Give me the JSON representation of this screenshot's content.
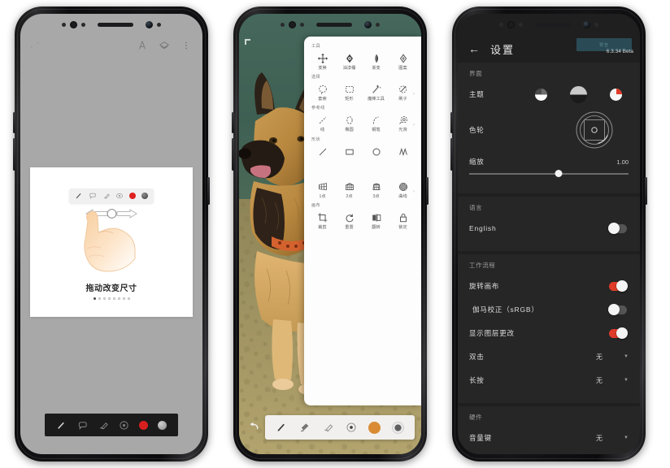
{
  "left_phone": {
    "topbar": {
      "icons": [
        "transform-icon",
        "layers-icon",
        "overflow-menu-icon"
      ],
      "corner_marker": "selection-corner-icon"
    },
    "tutorial_card": {
      "mini_toolbar_icons": [
        "brush-icon",
        "smudge-icon",
        "eraser-icon",
        "size-icon",
        "color-swatch-red",
        "layer-swatch-gray"
      ],
      "gesture_icon": "drag-hand-icon",
      "caption": "拖动改变尺寸",
      "page_count": 8,
      "active_page": 1
    },
    "bottom_toolbar": {
      "icons": [
        "brush-icon",
        "smudge-icon",
        "eraser-icon",
        "size-icon",
        "color-swatch-red",
        "layer-swatch-gray"
      ]
    },
    "canvas_bg": "#a8a8a8"
  },
  "mid_phone": {
    "artwork": {
      "subject": "german-shepherd-dog-painting",
      "sky_color": "#3e6053",
      "ground_color": "#a89a66"
    },
    "tool_panel": {
      "sections": [
        {
          "title": "工具",
          "items": [
            {
              "label": "变换",
              "icon": "transform-move-icon"
            },
            {
              "label": "油漆桶",
              "icon": "paint-bucket-icon"
            },
            {
              "label": "渐变",
              "icon": "gradient-icon"
            },
            {
              "label": "图案",
              "icon": "pattern-icon"
            }
          ]
        },
        {
          "title": "选择",
          "items": [
            {
              "label": "套索",
              "icon": "lasso-icon"
            },
            {
              "label": "矩形",
              "icon": "rect-marquee-icon"
            },
            {
              "label": "魔棒工具",
              "icon": "magic-wand-icon"
            },
            {
              "label": "刷子",
              "icon": "selection-brush-icon"
            }
          ],
          "has_more": true
        },
        {
          "title": "参考线",
          "items": [
            {
              "label": "线",
              "icon": "guide-line-icon"
            },
            {
              "label": "椭圆",
              "icon": "guide-ellipse-icon"
            },
            {
              "label": "钢笔",
              "icon": "guide-pen-icon"
            },
            {
              "label": "光滑",
              "icon": "guide-smooth-icon"
            }
          ],
          "has_more": true
        },
        {
          "title": "形状",
          "items": [
            {
              "label": "",
              "icon": "shape-line-icon"
            },
            {
              "label": "",
              "icon": "shape-rect-icon"
            },
            {
              "label": "",
              "icon": "shape-ellipse-icon"
            },
            {
              "label": "",
              "icon": "shape-polyline-icon"
            }
          ]
        },
        {
          "title": "",
          "items": [
            {
              "label": "1点",
              "icon": "perspective-1pt-icon"
            },
            {
              "label": "2点",
              "icon": "perspective-2pt-icon"
            },
            {
              "label": "3点",
              "icon": "perspective-3pt-icon"
            },
            {
              "label": "曲线",
              "icon": "perspective-curve-icon"
            }
          ],
          "has_more": true
        },
        {
          "title": "画布",
          "items": [
            {
              "label": "裁剪",
              "icon": "crop-icon"
            },
            {
              "label": "重置",
              "icon": "reset-rotate-icon"
            },
            {
              "label": "翻转",
              "icon": "flip-icon"
            },
            {
              "label": "锁定",
              "icon": "lock-icon"
            }
          ]
        }
      ]
    },
    "undo_icon": "undo-arrow-icon",
    "bottom_toolbar": {
      "icons": [
        "brush-icon",
        "smudge-icon",
        "eraser-icon",
        "size-icon",
        "color-swatch-orange",
        "layer-swatch-gray"
      ],
      "color_swatch": "#d98b33"
    }
  },
  "right_phone": {
    "appbar": {
      "back_icon": "back-arrow-icon",
      "title": "设置",
      "banner_text": "预告",
      "version": "6.3.34 Beta",
      "banner_color": "#2a4b56"
    },
    "sections": [
      {
        "title": "界面",
        "rows": [
          {
            "label": "主题",
            "type": "themes",
            "options": [
              "theme-dark",
              "theme-gray",
              "theme-red"
            ],
            "selected": 1
          },
          {
            "label": "色轮",
            "type": "wheel",
            "icon": "color-wheel-icon"
          },
          {
            "label": "缩放",
            "type": "slider",
            "value": "1.00",
            "position": 0.56
          }
        ]
      },
      {
        "title": "语言",
        "rows": [
          {
            "label": "English",
            "type": "switch",
            "on": false
          }
        ]
      },
      {
        "title": "工作流程",
        "rows": [
          {
            "label": "旋转画布",
            "type": "switch",
            "on": true
          },
          {
            "label": "伽马校正（sRGB）",
            "type": "switch",
            "on": false,
            "indent": true
          },
          {
            "label": "显示图层更改",
            "type": "switch",
            "on": true
          },
          {
            "label": "双击",
            "type": "select",
            "value": "无"
          },
          {
            "label": "长按",
            "type": "select",
            "value": "无"
          }
        ]
      },
      {
        "title": "硬件",
        "rows": [
          {
            "label": "音量键",
            "type": "select",
            "value": "无"
          }
        ]
      }
    ],
    "accent_on": "#e03a28",
    "accent_off": "#555555"
  }
}
